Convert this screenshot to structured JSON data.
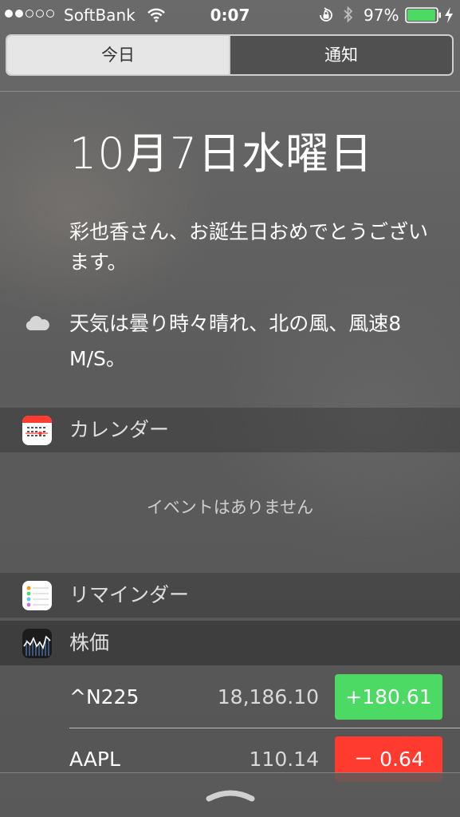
{
  "status_bar": {
    "signal_dots": [
      true,
      true,
      false,
      false,
      false
    ],
    "carrier": "SoftBank",
    "time": "0:07",
    "battery_percent": "97%",
    "battery_level": 0.97,
    "icons": [
      "wifi-icon",
      "orientation-lock-icon",
      "bluetooth-icon",
      "battery-icon",
      "charging-icon"
    ]
  },
  "tabs": [
    {
      "label": "今日",
      "selected": true
    },
    {
      "label": "通知",
      "selected": false
    }
  ],
  "today": {
    "date": "10月7日水曜日",
    "birthday_message": "彩也香さん、お誕生日おめでとうございます。",
    "weather_icon": "cloud-icon",
    "weather": "天気は曇り時々晴れ、北の風、風速8 M/S。"
  },
  "calendar": {
    "title": "カレンダー",
    "icon": "calendar-app-icon",
    "empty_message": "イベントはありません"
  },
  "reminders": {
    "title": "リマインダー",
    "icon": "reminders-app-icon"
  },
  "stocks": {
    "title": "株価",
    "icon": "stocks-app-icon",
    "items": [
      {
        "symbol": "^N225",
        "price": "18,186.10",
        "change": "+180.61",
        "direction": "up"
      },
      {
        "symbol": "AAPL",
        "price": "110.14",
        "change": "－ 0.64",
        "direction": "down"
      }
    ]
  },
  "colors": {
    "positive": "#4cd964",
    "negative": "#ff3b30"
  }
}
